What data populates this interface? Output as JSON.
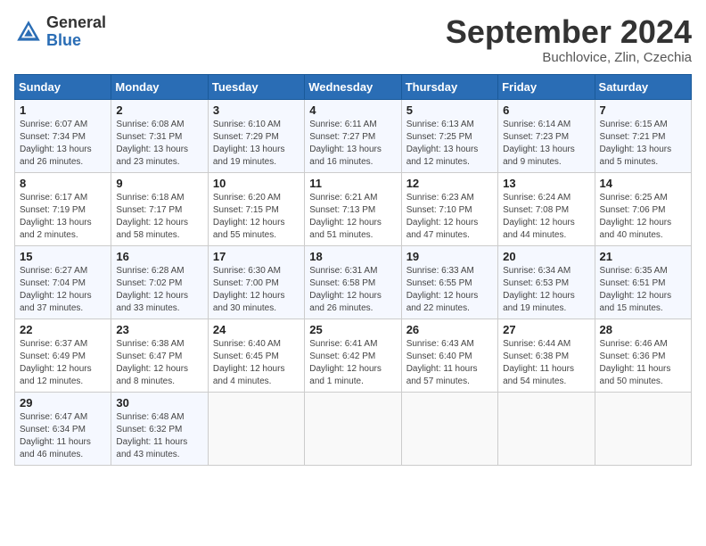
{
  "header": {
    "logo_general": "General",
    "logo_blue": "Blue",
    "title": "September 2024",
    "subtitle": "Buchlovice, Zlin, Czechia"
  },
  "weekdays": [
    "Sunday",
    "Monday",
    "Tuesday",
    "Wednesday",
    "Thursday",
    "Friday",
    "Saturday"
  ],
  "weeks": [
    [
      {
        "day": "1",
        "info": "Sunrise: 6:07 AM\nSunset: 7:34 PM\nDaylight: 13 hours\nand 26 minutes."
      },
      {
        "day": "2",
        "info": "Sunrise: 6:08 AM\nSunset: 7:31 PM\nDaylight: 13 hours\nand 23 minutes."
      },
      {
        "day": "3",
        "info": "Sunrise: 6:10 AM\nSunset: 7:29 PM\nDaylight: 13 hours\nand 19 minutes."
      },
      {
        "day": "4",
        "info": "Sunrise: 6:11 AM\nSunset: 7:27 PM\nDaylight: 13 hours\nand 16 minutes."
      },
      {
        "day": "5",
        "info": "Sunrise: 6:13 AM\nSunset: 7:25 PM\nDaylight: 13 hours\nand 12 minutes."
      },
      {
        "day": "6",
        "info": "Sunrise: 6:14 AM\nSunset: 7:23 PM\nDaylight: 13 hours\nand 9 minutes."
      },
      {
        "day": "7",
        "info": "Sunrise: 6:15 AM\nSunset: 7:21 PM\nDaylight: 13 hours\nand 5 minutes."
      }
    ],
    [
      {
        "day": "8",
        "info": "Sunrise: 6:17 AM\nSunset: 7:19 PM\nDaylight: 13 hours\nand 2 minutes."
      },
      {
        "day": "9",
        "info": "Sunrise: 6:18 AM\nSunset: 7:17 PM\nDaylight: 12 hours\nand 58 minutes."
      },
      {
        "day": "10",
        "info": "Sunrise: 6:20 AM\nSunset: 7:15 PM\nDaylight: 12 hours\nand 55 minutes."
      },
      {
        "day": "11",
        "info": "Sunrise: 6:21 AM\nSunset: 7:13 PM\nDaylight: 12 hours\nand 51 minutes."
      },
      {
        "day": "12",
        "info": "Sunrise: 6:23 AM\nSunset: 7:10 PM\nDaylight: 12 hours\nand 47 minutes."
      },
      {
        "day": "13",
        "info": "Sunrise: 6:24 AM\nSunset: 7:08 PM\nDaylight: 12 hours\nand 44 minutes."
      },
      {
        "day": "14",
        "info": "Sunrise: 6:25 AM\nSunset: 7:06 PM\nDaylight: 12 hours\nand 40 minutes."
      }
    ],
    [
      {
        "day": "15",
        "info": "Sunrise: 6:27 AM\nSunset: 7:04 PM\nDaylight: 12 hours\nand 37 minutes."
      },
      {
        "day": "16",
        "info": "Sunrise: 6:28 AM\nSunset: 7:02 PM\nDaylight: 12 hours\nand 33 minutes."
      },
      {
        "day": "17",
        "info": "Sunrise: 6:30 AM\nSunset: 7:00 PM\nDaylight: 12 hours\nand 30 minutes."
      },
      {
        "day": "18",
        "info": "Sunrise: 6:31 AM\nSunset: 6:58 PM\nDaylight: 12 hours\nand 26 minutes."
      },
      {
        "day": "19",
        "info": "Sunrise: 6:33 AM\nSunset: 6:55 PM\nDaylight: 12 hours\nand 22 minutes."
      },
      {
        "day": "20",
        "info": "Sunrise: 6:34 AM\nSunset: 6:53 PM\nDaylight: 12 hours\nand 19 minutes."
      },
      {
        "day": "21",
        "info": "Sunrise: 6:35 AM\nSunset: 6:51 PM\nDaylight: 12 hours\nand 15 minutes."
      }
    ],
    [
      {
        "day": "22",
        "info": "Sunrise: 6:37 AM\nSunset: 6:49 PM\nDaylight: 12 hours\nand 12 minutes."
      },
      {
        "day": "23",
        "info": "Sunrise: 6:38 AM\nSunset: 6:47 PM\nDaylight: 12 hours\nand 8 minutes."
      },
      {
        "day": "24",
        "info": "Sunrise: 6:40 AM\nSunset: 6:45 PM\nDaylight: 12 hours\nand 4 minutes."
      },
      {
        "day": "25",
        "info": "Sunrise: 6:41 AM\nSunset: 6:42 PM\nDaylight: 12 hours\nand 1 minute."
      },
      {
        "day": "26",
        "info": "Sunrise: 6:43 AM\nSunset: 6:40 PM\nDaylight: 11 hours\nand 57 minutes."
      },
      {
        "day": "27",
        "info": "Sunrise: 6:44 AM\nSunset: 6:38 PM\nDaylight: 11 hours\nand 54 minutes."
      },
      {
        "day": "28",
        "info": "Sunrise: 6:46 AM\nSunset: 6:36 PM\nDaylight: 11 hours\nand 50 minutes."
      }
    ],
    [
      {
        "day": "29",
        "info": "Sunrise: 6:47 AM\nSunset: 6:34 PM\nDaylight: 11 hours\nand 46 minutes."
      },
      {
        "day": "30",
        "info": "Sunrise: 6:48 AM\nSunset: 6:32 PM\nDaylight: 11 hours\nand 43 minutes."
      },
      {
        "day": "",
        "info": ""
      },
      {
        "day": "",
        "info": ""
      },
      {
        "day": "",
        "info": ""
      },
      {
        "day": "",
        "info": ""
      },
      {
        "day": "",
        "info": ""
      }
    ]
  ]
}
